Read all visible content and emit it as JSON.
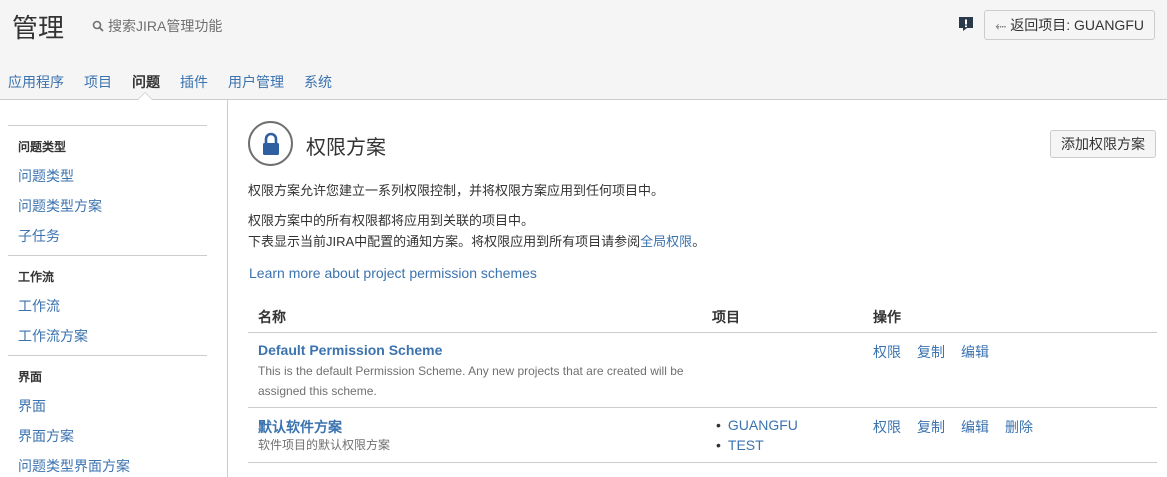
{
  "header": {
    "title": "管理",
    "search_text": "搜索JIRA管理功能",
    "back_button": "返回项目: GUANGFU"
  },
  "topnav": [
    "应用程序",
    "项目",
    "问题",
    "插件",
    "用户管理",
    "系统"
  ],
  "topnav_active": "问题",
  "sidebar": {
    "sections": [
      {
        "heading": "问题类型",
        "items": [
          "问题类型",
          "问题类型方案",
          "子任务"
        ]
      },
      {
        "heading": "工作流",
        "items": [
          "工作流",
          "工作流方案"
        ]
      },
      {
        "heading": "界面",
        "items": [
          "界面",
          "界面方案",
          "问题类型界面方案"
        ]
      }
    ]
  },
  "main": {
    "title": "权限方案",
    "add_button": "添加权限方案",
    "desc1": "权限方案允许您建立一系列权限控制，并将权限方案应用到任何项目中。",
    "desc2": "权限方案中的所有权限都将应用到关联的项目中。",
    "desc3_prefix": "下表显示当前JIRA中配置的通知方案。将权限应用到所有项目请参阅",
    "desc3_link": "全局权限",
    "desc3_suffix": "。",
    "learn_more": "Learn more about project permission schemes",
    "table": {
      "headers": [
        "名称",
        "项目",
        "操作"
      ],
      "rows": [
        {
          "name": "Default Permission Scheme",
          "desc_line1": "This is the default Permission Scheme. Any new projects that are created will be",
          "desc_line2": "assigned this scheme.",
          "projects": [],
          "ops": [
            "权限",
            "复制",
            "编辑"
          ]
        },
        {
          "name": "默认软件方案",
          "desc_line1": "软件项目的默认权限方案",
          "desc_line2": "",
          "projects": [
            "GUANGFU",
            "TEST"
          ],
          "ops": [
            "权限",
            "复制",
            "编辑",
            "删除"
          ]
        }
      ]
    }
  },
  "colors": {
    "link": "#3b73af",
    "header_bg": "#f5f5f5",
    "border": "#cccccc",
    "icon_dark": "#333333",
    "lock_blue": "#2f5f9e"
  }
}
